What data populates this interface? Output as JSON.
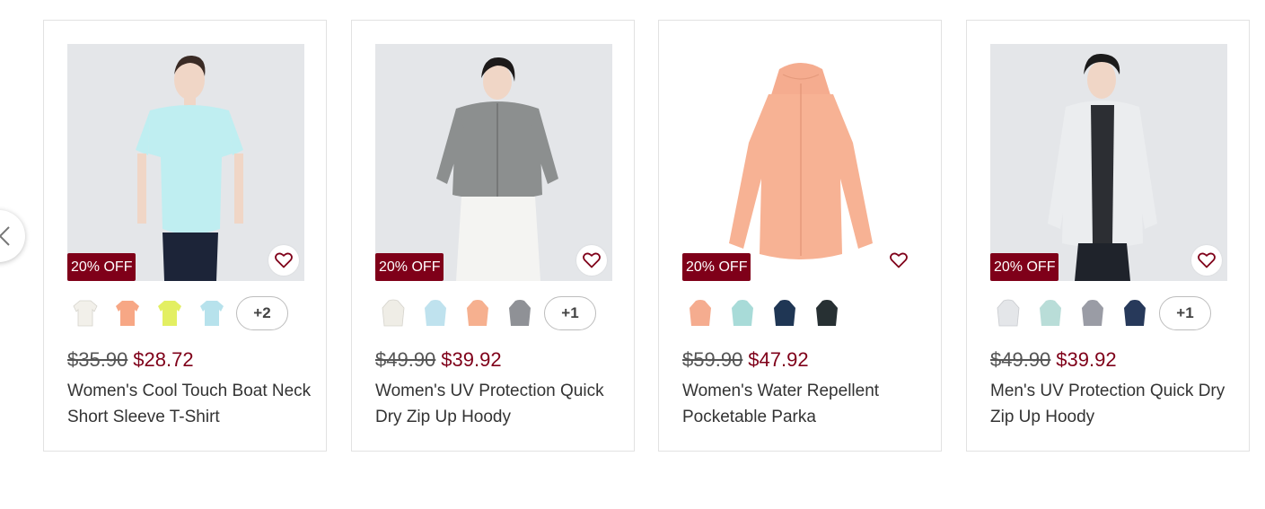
{
  "carousel": {
    "prev_icon": "chevron-left-icon"
  },
  "products": [
    {
      "badge": "20% OFF",
      "old_price": "$35.90",
      "new_price": "$28.72",
      "name": "Women's Cool Touch Boat Neck Short Sleeve T-Shirt",
      "more_colors": "+2",
      "swatches": [
        "#f2f0ea",
        "#f7a785",
        "#e3ef62",
        "#b7e2ec"
      ]
    },
    {
      "badge": "20% OFF",
      "old_price": "$49.90",
      "new_price": "$39.92",
      "name": "Women's UV Protection Quick Dry Zip Up Hoody",
      "more_colors": "+1",
      "swatches": [
        "#efede6",
        "#bfe2ee",
        "#f6b08f",
        "#8f9196"
      ]
    },
    {
      "badge": "20% OFF",
      "old_price": "$59.90",
      "new_price": "$47.92",
      "name": "Women's Water Repellent Pocketable Parka",
      "more_colors": "",
      "swatches": [
        "#f5ac8f",
        "#a8dbd8",
        "#1f3654",
        "#273033"
      ]
    },
    {
      "badge": "20% OFF",
      "old_price": "$49.90",
      "new_price": "$39.92",
      "name": "Men's UV Protection Quick Dry Zip Up Hoody",
      "more_colors": "+1",
      "swatches": [
        "#e4e6e9",
        "#b9ddd8",
        "#9a9ca5",
        "#27395a"
      ]
    }
  ],
  "colors": {
    "sale": "#7f0019",
    "border": "#e2e2e2"
  }
}
